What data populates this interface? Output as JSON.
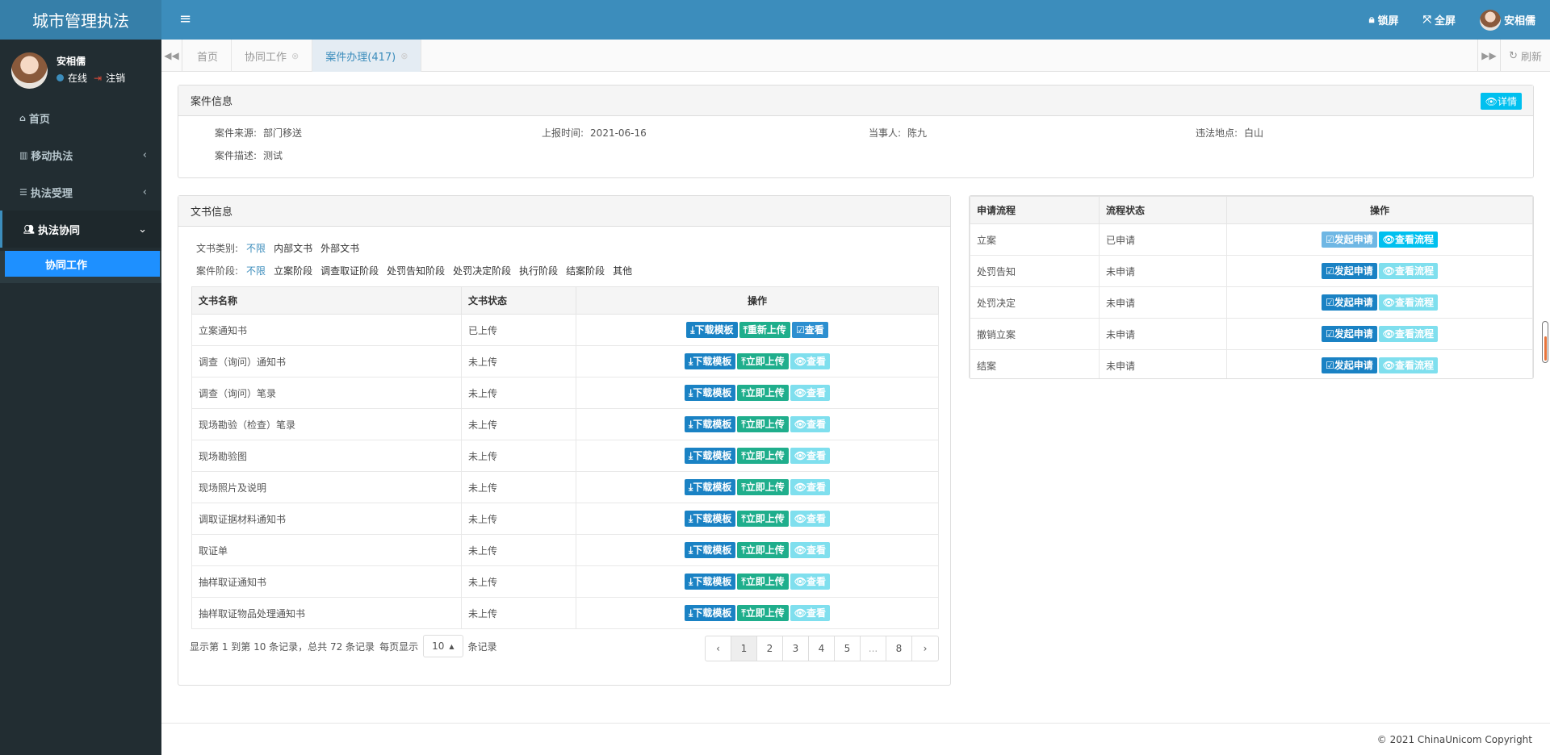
{
  "brand": "城市管理执法",
  "topbar": {
    "lock_label": "锁屏",
    "fullscreen_label": "全屏",
    "user_name": "安相儒"
  },
  "sidebar": {
    "user_name": "安相儒",
    "status_online": "在线",
    "logout": "注销",
    "items": [
      {
        "label": "首页",
        "icon": "home-icon"
      },
      {
        "label": "移动执法",
        "icon": "bank-icon"
      },
      {
        "label": "执法受理",
        "icon": "list-icon"
      },
      {
        "label": "执法协同",
        "icon": "users-icon"
      }
    ],
    "sub_item": "协同工作"
  },
  "tabs": [
    {
      "label": "首页"
    },
    {
      "label": "协同工作"
    },
    {
      "label": "案件办理(417)"
    }
  ],
  "refresh_label": "刷新",
  "case_info": {
    "title": "案件信息",
    "detail_btn": "详情",
    "source_label": "案件来源:",
    "source_value": "部门移送",
    "report_label": "上报时间:",
    "report_value": "2021-06-16",
    "party_label": "当事人:",
    "party_value": "陈九",
    "location_label": "违法地点:",
    "location_value": "白山",
    "desc_label": "案件描述:",
    "desc_value": "测试"
  },
  "doc_info": {
    "title": "文书信息",
    "category_label": "文书类别:",
    "category_options": [
      "不限",
      "内部文书",
      "外部文书"
    ],
    "stage_label": "案件阶段:",
    "stage_options": [
      "不限",
      "立案阶段",
      "调查取证阶段",
      "处罚告知阶段",
      "处罚决定阶段",
      "执行阶段",
      "结案阶段",
      "其他"
    ],
    "columns": [
      "文书名称",
      "文书状态",
      "操作"
    ],
    "rows": [
      {
        "name": "立案通知书",
        "status": "已上传",
        "uploaded": true
      },
      {
        "name": "调查（询问）通知书",
        "status": "未上传",
        "uploaded": false
      },
      {
        "name": "调查（询问）笔录",
        "status": "未上传",
        "uploaded": false
      },
      {
        "name": "现场勘验（检查）笔录",
        "status": "未上传",
        "uploaded": false
      },
      {
        "name": "现场勘验图",
        "status": "未上传",
        "uploaded": false
      },
      {
        "name": "现场照片及说明",
        "status": "未上传",
        "uploaded": false
      },
      {
        "name": "调取证据材料通知书",
        "status": "未上传",
        "uploaded": false
      },
      {
        "name": "取证单",
        "status": "未上传",
        "uploaded": false
      },
      {
        "name": "抽样取证通知书",
        "status": "未上传",
        "uploaded": false
      },
      {
        "name": "抽样取证物品处理通知书",
        "status": "未上传",
        "uploaded": false
      }
    ],
    "btn_download": "下载模板",
    "btn_reupload": "重新上传",
    "btn_upload": "立即上传",
    "btn_view": "查看",
    "pager_summary": "显示第 1 到第 10 条记录，总共 72 条记录",
    "pager_per_page": "每页显示",
    "pager_size": "10",
    "pager_suffix": "条记录",
    "pages": [
      "‹",
      "1",
      "2",
      "3",
      "4",
      "5",
      "...",
      "8",
      "›"
    ]
  },
  "flow": {
    "columns": [
      "申请流程",
      "流程状态",
      "操作"
    ],
    "rows": [
      {
        "name": "立案",
        "status": "已申请",
        "applied": true
      },
      {
        "name": "处罚告知",
        "status": "未申请",
        "applied": false
      },
      {
        "name": "处罚决定",
        "status": "未申请",
        "applied": false
      },
      {
        "name": "撤销立案",
        "status": "未申请",
        "applied": false
      },
      {
        "name": "结案",
        "status": "未申请",
        "applied": false
      }
    ],
    "btn_apply": "发起申请",
    "btn_view_flow": "查看流程"
  },
  "footer": "© 2021 ChinaUnicom Copyright"
}
